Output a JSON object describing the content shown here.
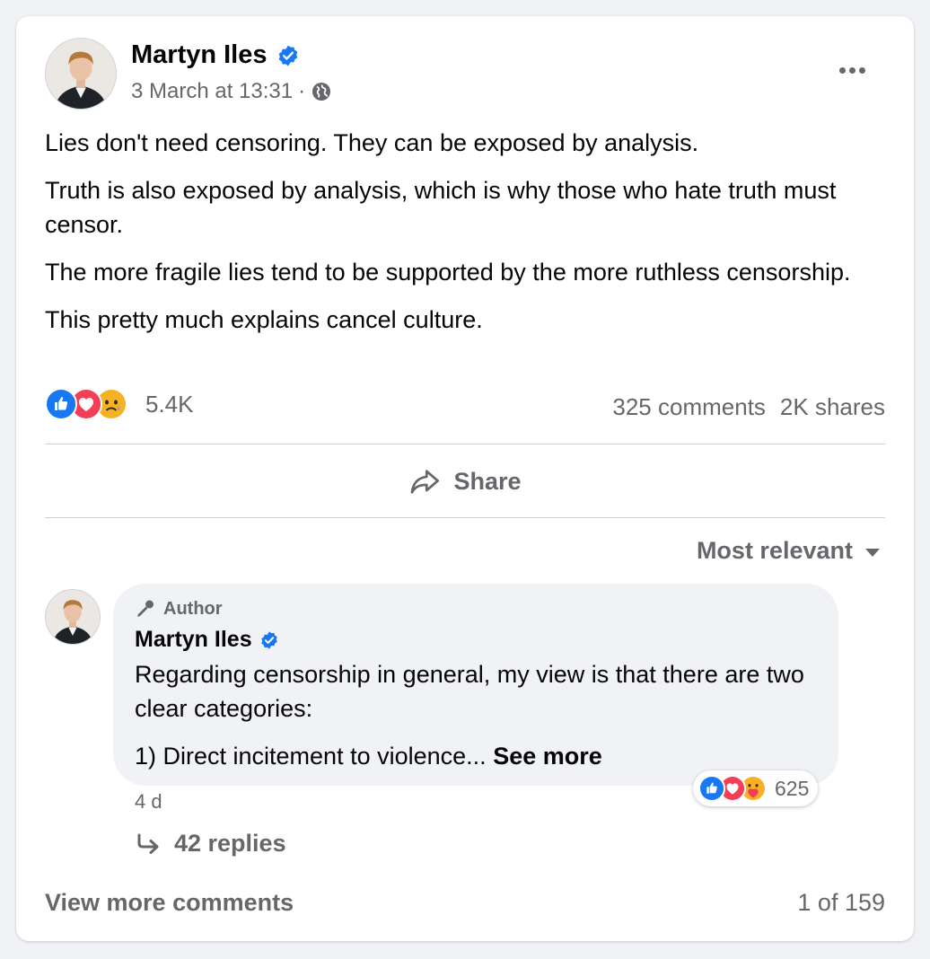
{
  "post": {
    "author": "Martyn Iles",
    "timestamp": "3 March at 13:31",
    "separator": "·",
    "paragraphs": [
      "Lies don't need censoring. They can be exposed by analysis.",
      "Truth is also exposed by analysis, which is why those who hate truth must censor.",
      "The more fragile lies tend to be supported by the more ruthless censorship.",
      "This pretty much explains cancel culture."
    ],
    "reaction_count": "5.4K",
    "comments_count": "325 comments",
    "shares_count": "2K shares"
  },
  "actions": {
    "share_label": "Share"
  },
  "sort": {
    "label": "Most relevant"
  },
  "comment": {
    "badge": "Author",
    "author": "Martyn Iles",
    "paragraphs": [
      "Regarding censorship in general, my view is that there are two clear categories:",
      "1) Direct incitement to violence..."
    ],
    "see_more": "See more",
    "reaction_count": "625",
    "time": "4 d",
    "replies": "42 replies"
  },
  "footer": {
    "view_more": "View more comments",
    "pager": "1 of 159"
  },
  "colors": {
    "verified": "#1877f2",
    "like": "#1877f2",
    "love": "#f33e58",
    "care_sad": "#f7b125",
    "secondary_text": "#65676b"
  },
  "icons": [
    "verified-icon",
    "globe-icon",
    "more-icon",
    "like-icon",
    "love-icon",
    "sad-icon",
    "care-icon",
    "share-icon",
    "caret-down-icon",
    "author-badge-icon",
    "reply-arrow-icon"
  ]
}
